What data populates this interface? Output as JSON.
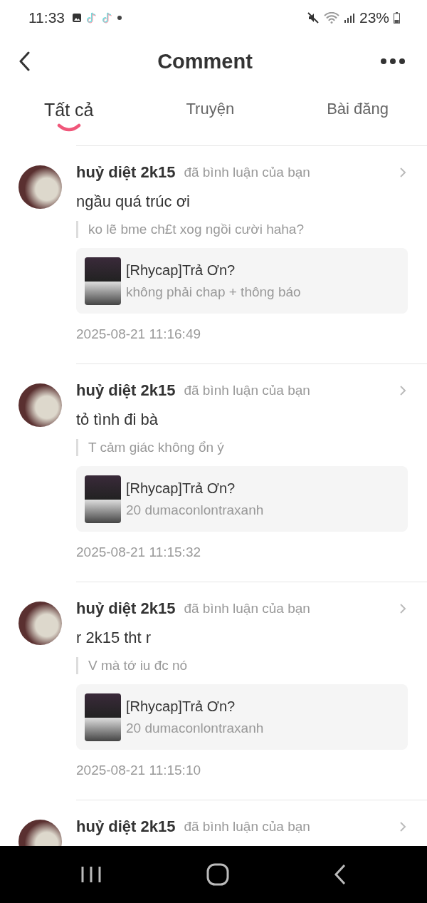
{
  "status_bar": {
    "time": "11:33",
    "battery": "23%"
  },
  "header": {
    "title": "Comment"
  },
  "tabs": [
    {
      "label": "Tất cả",
      "selected": true
    },
    {
      "label": "Truyện",
      "selected": false
    },
    {
      "label": "Bài đăng",
      "selected": false
    }
  ],
  "notifications": [
    {
      "user": "huỷ diệt 2k15",
      "action": "đã bình luận của bạn",
      "comment": "ngầu quá trúc ơi",
      "quote": "ko lẽ bme ch£t xog ngồi cười haha?",
      "story": {
        "title": "[Rhycap]Trả Ơn?",
        "subtitle": "không phải chap + thông báo"
      },
      "time": "2025-08-21 11:16:49"
    },
    {
      "user": "huỷ diệt 2k15",
      "action": "đã bình luận của bạn",
      "comment": "tỏ tình đi bà",
      "quote": "T cảm giác không ổn ý",
      "story": {
        "title": "[Rhycap]Trả Ơn?",
        "subtitle": "20 dumaconlontraxanh"
      },
      "time": "2025-08-21 11:15:32"
    },
    {
      "user": "huỷ diệt 2k15",
      "action": "đã bình luận của bạn",
      "comment": "r 2k15 tht r",
      "quote": "V mà tớ iu đc nó",
      "story": {
        "title": "[Rhycap]Trả Ơn?",
        "subtitle": "20 dumaconlontraxanh"
      },
      "time": "2025-08-21 11:15:10"
    },
    {
      "user": "huỷ diệt 2k15",
      "action": "đã bình luận của bạn"
    }
  ]
}
